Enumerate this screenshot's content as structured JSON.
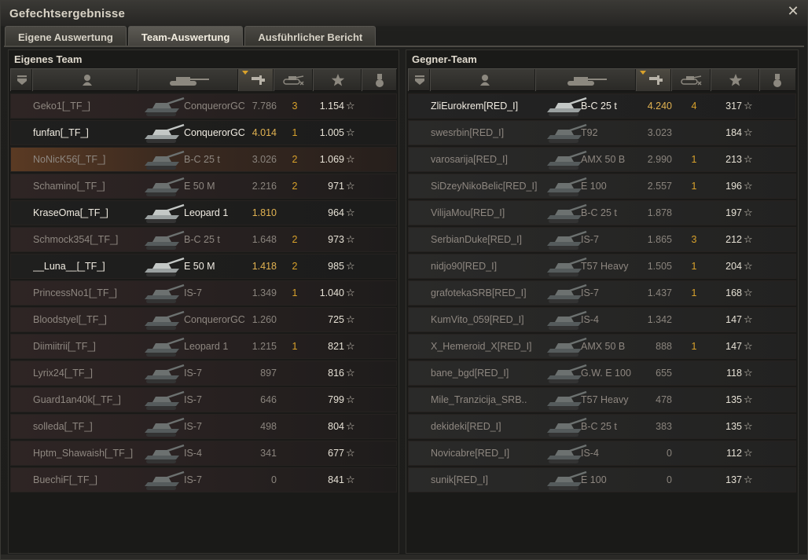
{
  "window": {
    "title": "Gefechtsergebnisse"
  },
  "tabs": [
    {
      "label": "Eigene Auswertung",
      "active": false
    },
    {
      "label": "Team-Auswertung",
      "active": true
    },
    {
      "label": "Ausführlicher Bericht",
      "active": false
    }
  ],
  "own_team": {
    "title": "Eigenes Team",
    "columns": [
      "squad",
      "player",
      "vehicle",
      "xp",
      "kills",
      "damage",
      "medal"
    ],
    "sorted_column": "xp",
    "rows": [
      {
        "player": "Geko1[_TF_]",
        "tank": "ConquerorGC",
        "xp": "7.786",
        "kills": "3",
        "damage": "1.154",
        "bright": false,
        "highlight": false
      },
      {
        "player": "funfan[_TF_]",
        "tank": "ConquerorGC",
        "xp": "4.014",
        "kills": "1",
        "damage": "1.005",
        "bright": true,
        "highlight": false
      },
      {
        "player": "NoNicK56[_TF_]",
        "tank": "B-C 25 t",
        "xp": "3.026",
        "kills": "2",
        "damage": "1.069",
        "bright": false,
        "highlight": true
      },
      {
        "player": "Schamino[_TF_]",
        "tank": "E 50 M",
        "xp": "2.216",
        "kills": "2",
        "damage": "971",
        "bright": false,
        "highlight": false
      },
      {
        "player": "KraseOma[_TF_]",
        "tank": "Leopard 1",
        "xp": "1.810",
        "kills": "",
        "damage": "964",
        "bright": true,
        "highlight": false
      },
      {
        "player": "Schmock354[_TF_]",
        "tank": "B-C 25 t",
        "xp": "1.648",
        "kills": "2",
        "damage": "973",
        "bright": false,
        "highlight": false
      },
      {
        "player": "__Luna__[_TF_]",
        "tank": "E 50 M",
        "xp": "1.418",
        "kills": "2",
        "damage": "985",
        "bright": true,
        "highlight": false
      },
      {
        "player": "PrincessNo1[_TF_]",
        "tank": "IS-7",
        "xp": "1.349",
        "kills": "1",
        "damage": "1.040",
        "bright": false,
        "highlight": false
      },
      {
        "player": "Bloodstyel[_TF_]",
        "tank": "ConquerorGC",
        "xp": "1.260",
        "kills": "",
        "damage": "725",
        "bright": false,
        "highlight": false
      },
      {
        "player": "Diimiitrii[_TF_]",
        "tank": "Leopard 1",
        "xp": "1.215",
        "kills": "1",
        "damage": "821",
        "bright": false,
        "highlight": false
      },
      {
        "player": "Lyrix24[_TF_]",
        "tank": "IS-7",
        "xp": "897",
        "kills": "",
        "damage": "816",
        "bright": false,
        "highlight": false
      },
      {
        "player": "Guard1an40k[_TF_]",
        "tank": "IS-7",
        "xp": "646",
        "kills": "",
        "damage": "799",
        "bright": false,
        "highlight": false
      },
      {
        "player": "solleda[_TF_]",
        "tank": "IS-7",
        "xp": "498",
        "kills": "",
        "damage": "804",
        "bright": false,
        "highlight": false
      },
      {
        "player": "Hptm_Shawaish[_TF_]",
        "tank": "IS-4",
        "xp": "341",
        "kills": "",
        "damage": "677",
        "bright": false,
        "highlight": false
      },
      {
        "player": "BuechiF[_TF_]",
        "tank": "IS-7",
        "xp": "0",
        "kills": "",
        "damage": "841",
        "bright": false,
        "highlight": false
      }
    ]
  },
  "enemy_team": {
    "title": "Gegner-Team",
    "rows": [
      {
        "player": "ZliEurokrem[RED_I]",
        "tank": "B-C 25 t",
        "xp": "4.240",
        "kills": "4",
        "damage": "317",
        "bright": true
      },
      {
        "player": "swesrbin[RED_I]",
        "tank": "T92",
        "xp": "3.023",
        "kills": "",
        "damage": "184",
        "bright": false
      },
      {
        "player": "varosarija[RED_I]",
        "tank": "AMX 50 B",
        "xp": "2.990",
        "kills": "1",
        "damage": "213",
        "bright": false
      },
      {
        "player": "SiDzeyNikoBelic[RED_I]",
        "tank": "E 100",
        "xp": "2.557",
        "kills": "1",
        "damage": "196",
        "bright": false
      },
      {
        "player": "ViliјaMou[RED_I]",
        "tank": "B-C 25 t",
        "xp": "1.878",
        "kills": "",
        "damage": "197",
        "bright": false
      },
      {
        "player": "SerbianDuke[RED_I]",
        "tank": "IS-7",
        "xp": "1.865",
        "kills": "3",
        "damage": "212",
        "bright": false
      },
      {
        "player": "nidjo90[RED_I]",
        "tank": "T57 Heavy",
        "xp": "1.505",
        "kills": "1",
        "damage": "204",
        "bright": false
      },
      {
        "player": "grafotekaSRB[RED_I]",
        "tank": "IS-7",
        "xp": "1.437",
        "kills": "1",
        "damage": "168",
        "bright": false
      },
      {
        "player": "KumVito_059[RED_I]",
        "tank": "IS-4",
        "xp": "1.342",
        "kills": "",
        "damage": "147",
        "bright": false
      },
      {
        "player": "X_Hemeroid_X[RED_I]",
        "tank": "AMX 50 B",
        "xp": "888",
        "kills": "1",
        "damage": "147",
        "bright": false
      },
      {
        "player": "bane_bgd[RED_I]",
        "tank": "G.W. E 100",
        "xp": "655",
        "kills": "",
        "damage": "118",
        "bright": false
      },
      {
        "player": "Mile_Tranzicija_SRB..",
        "tank": "T57 Heavy",
        "xp": "478",
        "kills": "",
        "damage": "135",
        "bright": false
      },
      {
        "player": "dekideki[RED_I]",
        "tank": "B-C 25 t",
        "xp": "383",
        "kills": "",
        "damage": "135",
        "bright": false
      },
      {
        "player": "Novicabre[RED_I]",
        "tank": "IS-4",
        "xp": "0",
        "kills": "",
        "damage": "112",
        "bright": false
      },
      {
        "player": "sunik[RED_I]",
        "tank": "E 100",
        "xp": "0",
        "kills": "",
        "damage": "137",
        "bright": false
      }
    ]
  },
  "icons": {
    "close": "close-icon",
    "squad": "squad-icon",
    "player": "player-icon",
    "vehicle": "tank-icon",
    "xp": "xp-icon",
    "kills": "kills-icon",
    "damage": "star-icon",
    "medal": "medal-icon"
  },
  "colors": {
    "xp_highlight": "#e1b251",
    "kills": "#d8a12b",
    "sort_arrow": "#d8a12b"
  }
}
